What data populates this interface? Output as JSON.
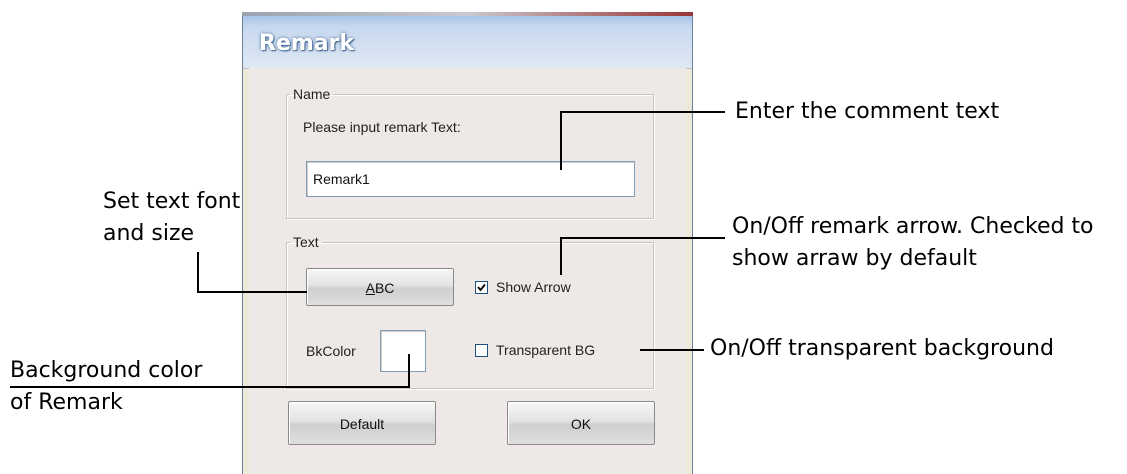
{
  "dialog": {
    "title": "Remark",
    "name_group": {
      "legend": "Name",
      "prompt": "Please input remark Text:",
      "text_value": "Remark1"
    },
    "text_group": {
      "legend": "Text",
      "font_button_label": "ABC",
      "show_arrow_label": "Show Arrow",
      "show_arrow_checked": true,
      "bkcolor_label": "BkColor",
      "bkcolor_value": "#ffffff",
      "transparent_bg_label": "Transparent BG",
      "transparent_bg_checked": false
    },
    "buttons": {
      "default_label": "Default",
      "ok_label": "OK"
    }
  },
  "annotations": {
    "enter_text": "Enter the comment text",
    "set_font_line1": "Set text font",
    "set_font_line2": "and size",
    "arrow_line1": "On/Off remark arrow. Checked to",
    "arrow_line2": "show arraw by default",
    "transparent": "On/Off transparent background",
    "bkcolor_line1": "Background color",
    "bkcolor_line2": "of Remark"
  }
}
